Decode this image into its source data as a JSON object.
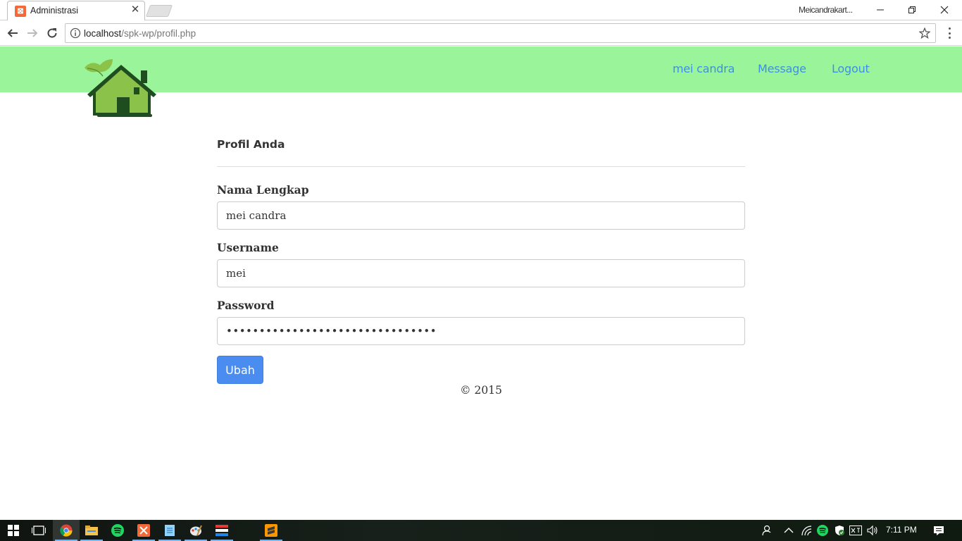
{
  "browser": {
    "tab_title": "Administrasi",
    "profile_name": "Meicandrakart...",
    "url_host": "localhost",
    "url_path": "/spk-wp/profil.php"
  },
  "nav": {
    "user": "mei candra",
    "message": "Message",
    "logout": "Logout"
  },
  "form": {
    "title": "Profil Anda",
    "nama_label": "Nama Lengkap",
    "nama_value": "mei candra",
    "username_label": "Username",
    "username_value": "mei",
    "password_label": "Password",
    "password_value": "••••••••••••••••••••••••••••••••",
    "submit_label": "Ubah"
  },
  "footer": "© 2015",
  "taskbar": {
    "clock": "7:11 PM",
    "pinned_apps": [
      "windows-start",
      "task-view",
      "chrome",
      "file-explorer",
      "spotify",
      "xampp",
      "notepad",
      "paint",
      "app-grid",
      "sublime-text"
    ]
  },
  "colors": {
    "header_bg": "#9af59a",
    "link": "#3e8ee6",
    "button": "#4a8cef",
    "logo_green": "#8bc34a",
    "logo_dark": "#1f4d1f"
  }
}
